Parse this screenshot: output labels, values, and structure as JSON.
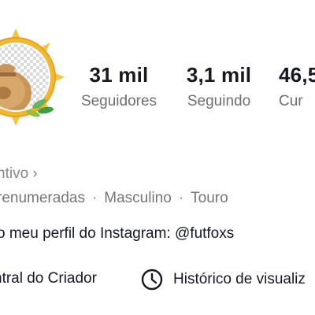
{
  "stats": {
    "followers": {
      "value": "31 mil",
      "label": "Seguidores"
    },
    "following": {
      "value": "3,1 mil",
      "label": "Seguindo"
    },
    "likes": {
      "value": "46,5",
      "label": "Cur"
    }
  },
  "profile": {
    "incentive_text": "ntivo",
    "chevron": "›",
    "tags": [
      "renumeradas",
      "Masculino",
      "Touro"
    ],
    "tag_separator": "·",
    "bio": "o meu perfil do Instagram: @futfoxs"
  },
  "shortcuts": {
    "creator_center": "ntral do Criador",
    "history": "Histórico de visualiz",
    "history_icon": "clock-icon"
  },
  "colors": {
    "primary_text": "#161823",
    "secondary_text": "#6f6f73",
    "avatar_gold": "#f2b733"
  }
}
